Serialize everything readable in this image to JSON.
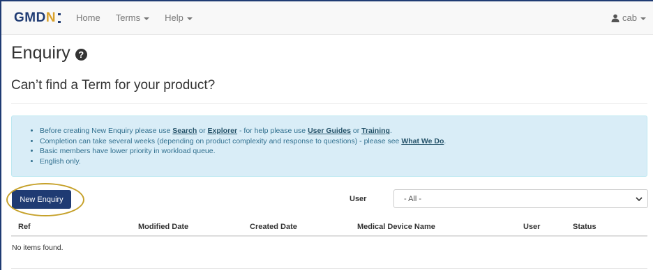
{
  "navbar": {
    "logo_main": "GMD",
    "logo_accent": "N",
    "items": [
      {
        "label": "Home",
        "has_dropdown": false
      },
      {
        "label": "Terms",
        "has_dropdown": true
      },
      {
        "label": "Help",
        "has_dropdown": true
      }
    ],
    "user": {
      "label": "cab",
      "icon": "user-icon"
    }
  },
  "page": {
    "title": "Enquiry",
    "title_icon": "help-circle-icon",
    "subtitle": "Can’t find a Term for your product?"
  },
  "info": {
    "line1_a": "Before creating New Enquiry please use ",
    "link_search": "Search",
    "line1_b": " or ",
    "link_explorer": "Explorer",
    "line1_c": " - for help please use ",
    "link_user_guides": "User Guides",
    "line1_d": " or ",
    "link_training": "Training",
    "line1_e": ".",
    "line2_a": "Completion can take several weeks (depending on product complexity and response to questions) - please see ",
    "link_what_we_do": "What We Do",
    "line2_b": ".",
    "line3": "Basic members have lower priority in workload queue.",
    "line4": "English only."
  },
  "actions": {
    "new_enquiry_label": "New Enquiry",
    "user_filter_label": "User",
    "user_filter_value": "- All -"
  },
  "table": {
    "headers": [
      "Ref",
      "Modified Date",
      "Created Date",
      "Medical Device Name",
      "User",
      "Status"
    ],
    "empty_text": "No items found."
  },
  "colors": {
    "brand": "#1f3b73",
    "accent": "#d8a02a",
    "highlight_ring": "#c6a12a",
    "info_bg": "#d9edf7"
  }
}
